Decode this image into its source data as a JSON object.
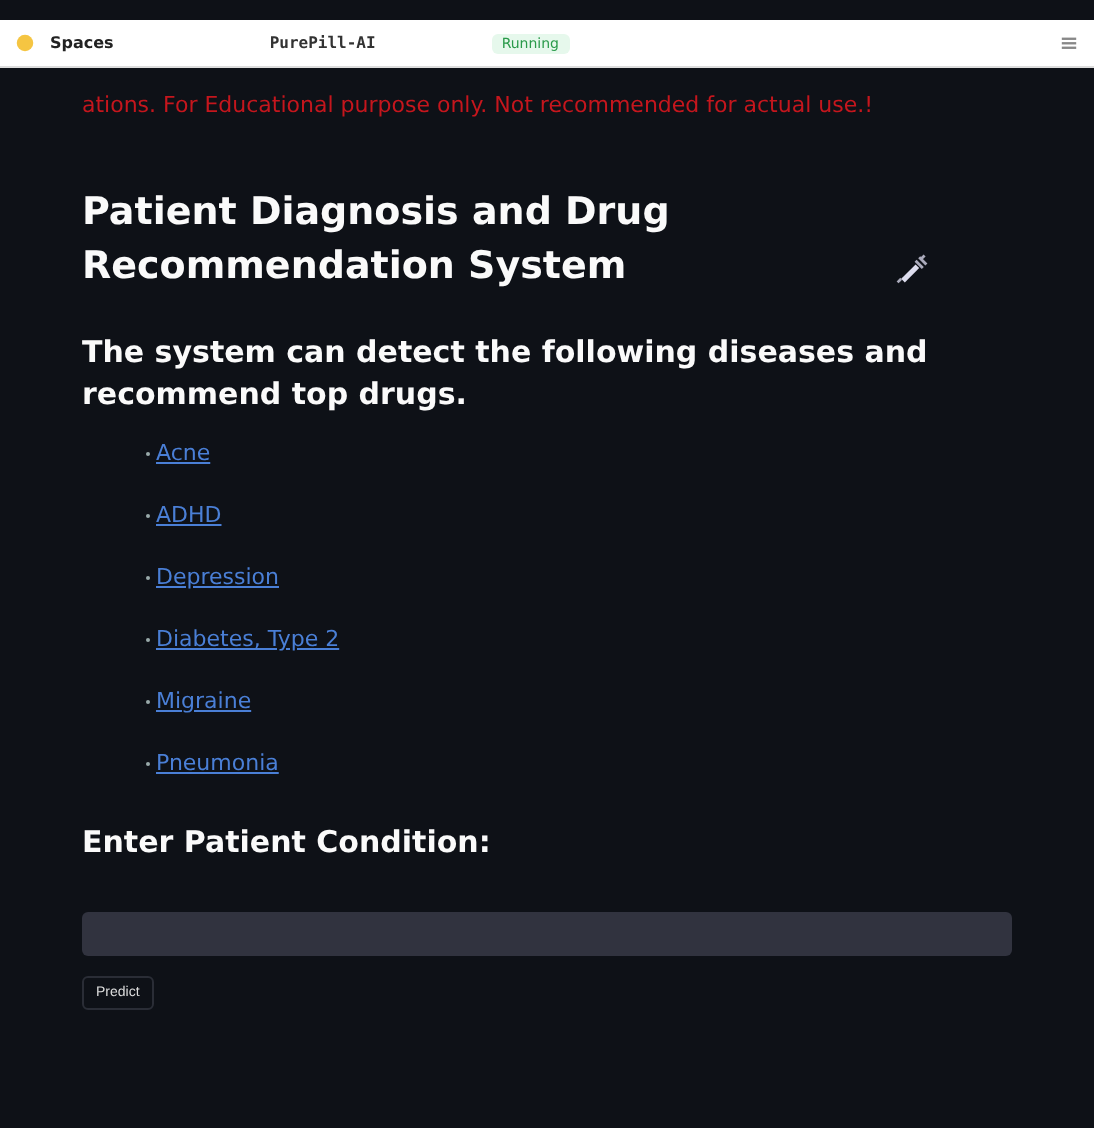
{
  "header": {
    "brand": "Spaces",
    "app_name": "PurePill-AI",
    "status": "Running"
  },
  "warning": "ations. For Educational purpose only. Not recommended for actual use.!",
  "title": "Patient Diagnosis and Drug Recommendation System",
  "subtitle": "The system can detect the following diseases and recommend top drugs.",
  "diseases": [
    "Acne",
    "ADHD",
    "Depression",
    "Diabetes, Type 2",
    "Migraine",
    "Pneumonia"
  ],
  "input_label": "Enter Patient Condition:",
  "button": "Predict"
}
